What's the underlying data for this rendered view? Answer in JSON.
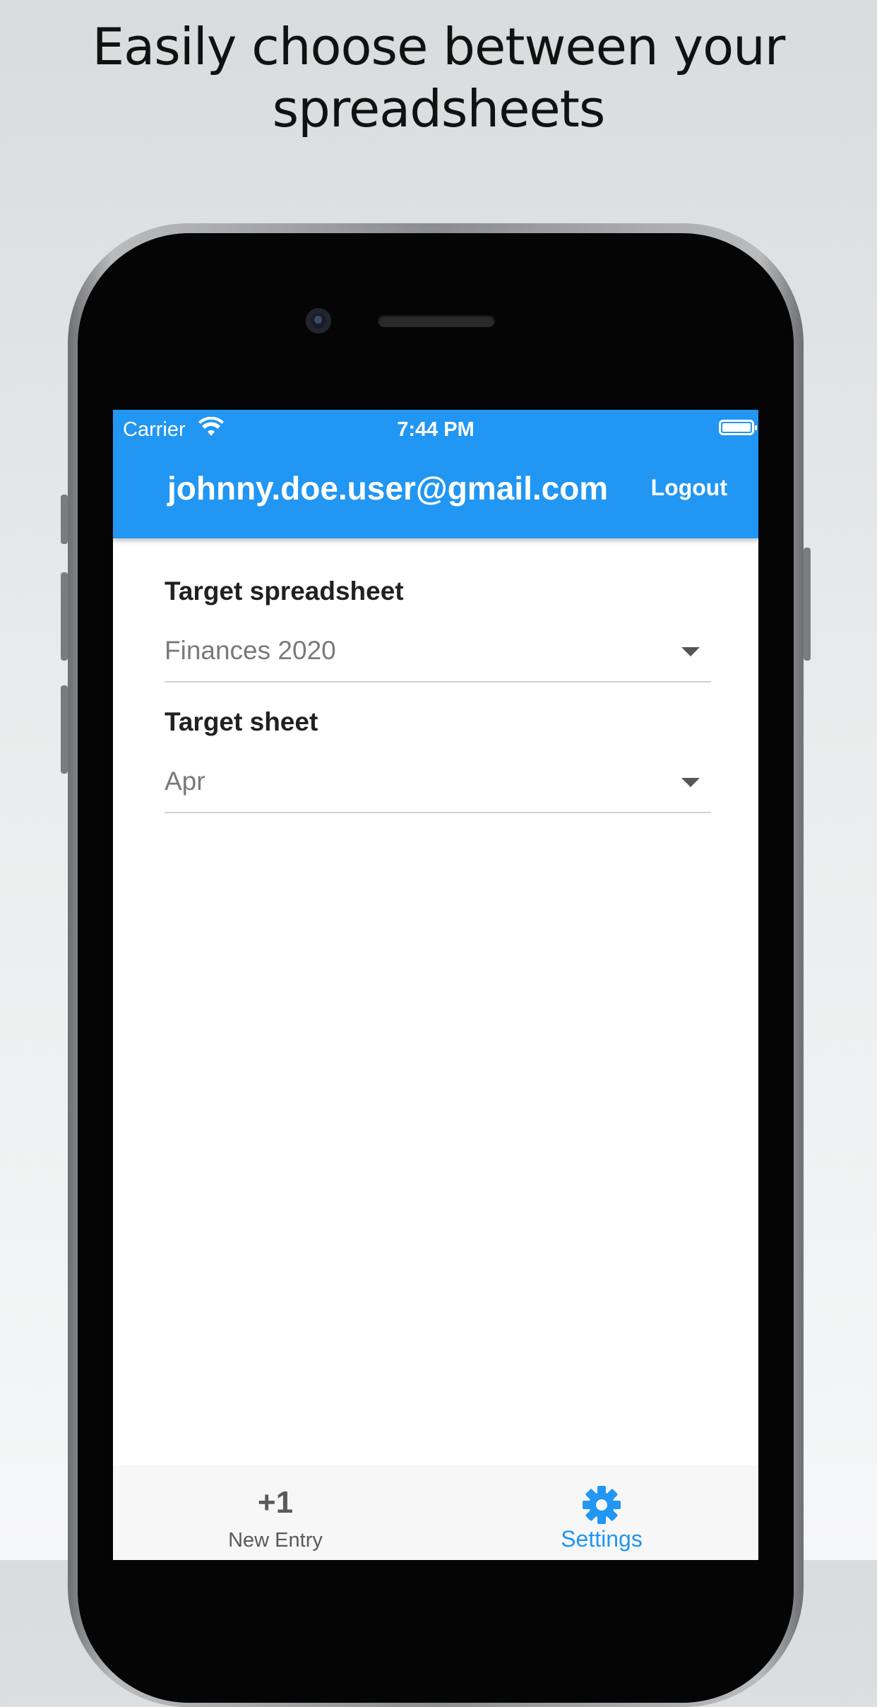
{
  "headline": {
    "line1": "Easily choose between your",
    "line2": "spreadsheets"
  },
  "status_bar": {
    "carrier": "Carrier",
    "time": "7:44 PM",
    "wifi_icon": "wifi-icon",
    "battery_icon": "battery-icon"
  },
  "app_bar": {
    "title": "johnny.doe.user@gmail.com",
    "logout_label": "Logout",
    "background": "#2196f3"
  },
  "settings": {
    "spreadsheet": {
      "label": "Target spreadsheet",
      "value": "Finances 2020"
    },
    "sheet": {
      "label": "Target sheet",
      "value": "Apr"
    }
  },
  "bottom_nav": {
    "items": [
      {
        "icon_text": "+1",
        "label": "New Entry",
        "active": false
      },
      {
        "icon": "gear-icon",
        "label": "Settings",
        "active": true
      }
    ],
    "active_color": "#2196f3",
    "inactive_color": "#5a5a5a"
  }
}
